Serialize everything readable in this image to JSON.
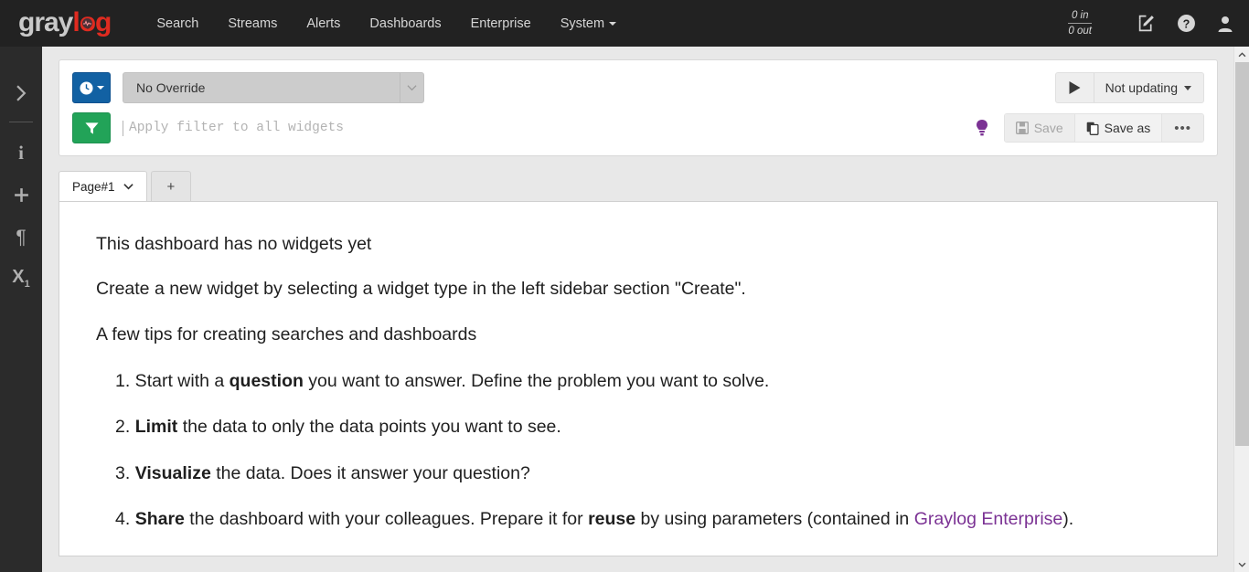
{
  "navbar": {
    "logo": {
      "part1": "gray",
      "part2": "log",
      "icon": "pulse-icon"
    },
    "links": [
      {
        "label": "Search",
        "name": "nav-link-search",
        "caret": false
      },
      {
        "label": "Streams",
        "name": "nav-link-streams",
        "caret": false
      },
      {
        "label": "Alerts",
        "name": "nav-link-alerts",
        "caret": false
      },
      {
        "label": "Dashboards",
        "name": "nav-link-dashboards",
        "caret": false
      },
      {
        "label": "Enterprise",
        "name": "nav-link-enterprise",
        "caret": false
      },
      {
        "label": "System",
        "name": "nav-link-system",
        "caret": true
      }
    ],
    "throughput": {
      "in": "0 in",
      "out": "0 out"
    },
    "icons": [
      "edit-icon",
      "help-icon",
      "user-icon"
    ]
  },
  "sidebar": {
    "items": [
      {
        "name": "sidebar-toggle-expand-icon",
        "glyph": "chevron-right-icon"
      },
      {
        "name": "sidebar-item-info-icon",
        "glyph": "info-icon"
      },
      {
        "name": "sidebar-item-create-icon",
        "glyph": "plus-icon"
      },
      {
        "name": "sidebar-item-highlighting-icon",
        "glyph": "pilcrow-icon"
      },
      {
        "name": "sidebar-item-fields-icon",
        "glyph": "subscript-icon"
      }
    ]
  },
  "query_bar": {
    "timerange_button": {
      "icon": "clock-icon",
      "label": ""
    },
    "override_select": {
      "value": "No Override",
      "name": "streams-override-select"
    },
    "refresh": {
      "play_icon": "play-icon",
      "label": "Not updating"
    },
    "filter_button": {
      "icon": "filter-icon"
    },
    "filter_input": {
      "value": "",
      "placeholder": "Apply filter to all widgets"
    },
    "hint_icon": "lightbulb-icon",
    "save_label": "Save",
    "save_as_label": "Save as",
    "more_label": "•••"
  },
  "tabs": [
    {
      "label": "Page#1",
      "active": true,
      "name": "tab-page-1"
    },
    {
      "label": "+",
      "active": false,
      "name": "tab-add-page"
    }
  ],
  "empty_dashboard": {
    "heading": "This dashboard has no widgets yet",
    "subheading": "Create a new widget by selecting a widget type in the left sidebar section \"Create\".",
    "tips_title": "A few tips for creating searches and dashboards",
    "tips": [
      {
        "num": "1.",
        "pre": " Start with a ",
        "bold": "question",
        "post": " you want to answer. Define the problem you want to solve.",
        "bold2": "",
        "post2": "",
        "link": "",
        "tail": ""
      },
      {
        "num": "2.",
        "pre": " ",
        "bold": "Limit",
        "post": " the data to only the data points you want to see.",
        "bold2": "",
        "post2": "",
        "link": "",
        "tail": ""
      },
      {
        "num": "3.",
        "pre": " ",
        "bold": "Visualize",
        "post": " the data. Does it answer your question?",
        "bold2": "",
        "post2": "",
        "link": "",
        "tail": ""
      },
      {
        "num": "4.",
        "pre": " ",
        "bold": "Share",
        "post": " the dashboard with your colleagues. Prepare it for ",
        "bold2": "reuse",
        "post2": " by using parameters (contained in ",
        "link": "Graylog Enterprise",
        "tail": ")."
      }
    ]
  },
  "colors": {
    "navbar_bg": "#222222",
    "sidebar_bg": "#2b2b2b",
    "page_bg": "#e8e8e8",
    "primary_blue": "#1261a3",
    "filter_green": "#22a358",
    "link_purple": "#7b3294",
    "logo_red": "#e02b20"
  }
}
